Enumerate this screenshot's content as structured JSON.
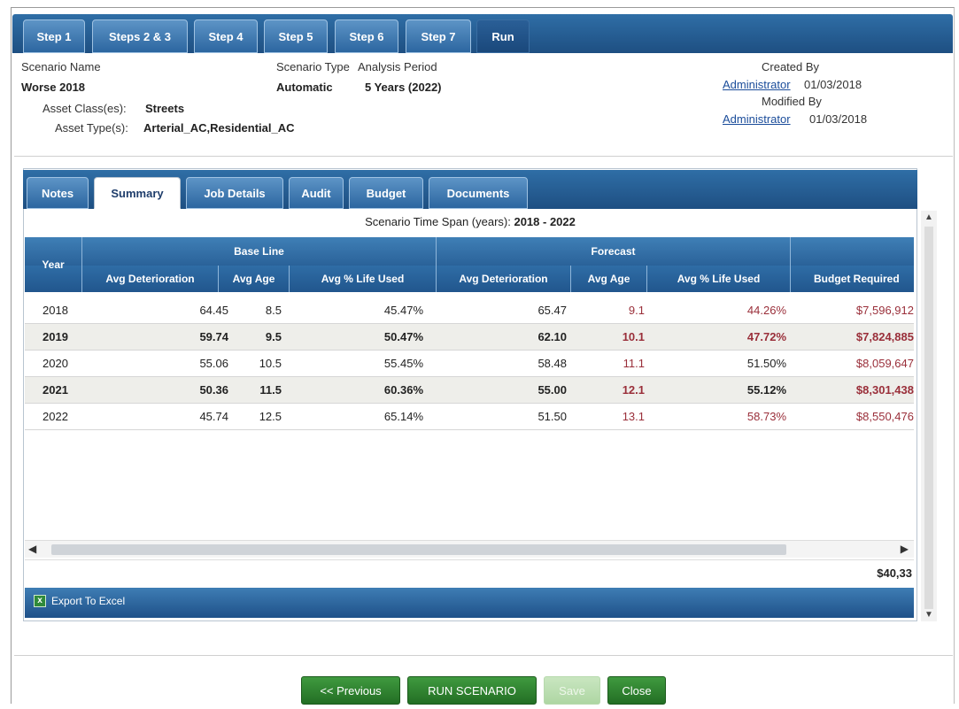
{
  "steps": [
    {
      "label": "Step 1"
    },
    {
      "label": "Steps 2 & 3"
    },
    {
      "label": "Step 4"
    },
    {
      "label": "Step 5"
    },
    {
      "label": "Step 6"
    },
    {
      "label": "Step 7"
    },
    {
      "label": "Run"
    }
  ],
  "header": {
    "scenario_name_label": "Scenario Name",
    "scenario_name": "Worse 2018",
    "scenario_type_label": "Scenario Type",
    "scenario_type": "Automatic",
    "analysis_period_label": "Analysis Period",
    "analysis_period": "5 Years (2022)",
    "asset_class_label": "Asset Class(es):",
    "asset_class": "Streets",
    "asset_type_label": "Asset Type(s):",
    "asset_type": "Arterial_AC,Residential_AC",
    "created_by_label": "Created By",
    "created_by_user": "Administrator",
    "created_date": "01/03/2018",
    "modified_by_label": "Modified By",
    "modified_by_user": "Administrator",
    "modified_date": "01/03/2018"
  },
  "subtabs": [
    {
      "label": "Notes"
    },
    {
      "label": "Summary"
    },
    {
      "label": "Job Details"
    },
    {
      "label": "Audit"
    },
    {
      "label": "Budget"
    },
    {
      "label": "Documents"
    }
  ],
  "summary": {
    "time_span_label": "Scenario Time Span (years):",
    "time_span": "2018 - 2022",
    "group_headers": {
      "year": "Year",
      "baseline": "Base Line",
      "forecast": "Forecast"
    },
    "columns": {
      "avg_det": "Avg Deterioration",
      "avg_age": "Avg Age",
      "avg_life": "Avg % Life Used",
      "f_avg_det": "Avg Deterioration",
      "f_avg_age": "Avg Age",
      "f_avg_life": "Avg % Life Used",
      "budget": "Budget Required"
    },
    "rows": [
      {
        "year": "2018",
        "bl_det": "64.45",
        "bl_age": "8.5",
        "bl_life": "45.47%",
        "fc_det": "65.47",
        "fc_age": "9.1",
        "fc_life": "44.26%",
        "budget": "$7,596,912"
      },
      {
        "year": "2019",
        "bl_det": "59.74",
        "bl_age": "9.5",
        "bl_life": "50.47%",
        "fc_det": "62.10",
        "fc_age": "10.1",
        "fc_life": "47.72%",
        "budget": "$7,824,885"
      },
      {
        "year": "2020",
        "bl_det": "55.06",
        "bl_age": "10.5",
        "bl_life": "55.45%",
        "fc_det": "58.48",
        "fc_age": "11.1",
        "fc_life": "51.50%",
        "budget": "$8,059,647"
      },
      {
        "year": "2021",
        "bl_det": "50.36",
        "bl_age": "11.5",
        "bl_life": "60.36%",
        "fc_det": "55.00",
        "fc_age": "12.1",
        "fc_life": "55.12%",
        "budget": "$8,301,438"
      },
      {
        "year": "2022",
        "bl_det": "45.74",
        "bl_age": "12.5",
        "bl_life": "65.14%",
        "fc_det": "51.50",
        "fc_age": "13.1",
        "fc_life": "58.73%",
        "budget": "$8,550,476"
      }
    ],
    "total_budget": "$40,33",
    "export_label": "Export To Excel"
  },
  "buttons": {
    "previous": "<< Previous",
    "run": "RUN SCENARIO",
    "save": "Save",
    "close": "Close"
  },
  "colors": {
    "tab_blue": "#2c66a0",
    "button_green": "#2f8a2f",
    "forecast_red": "#9a2f3a"
  }
}
